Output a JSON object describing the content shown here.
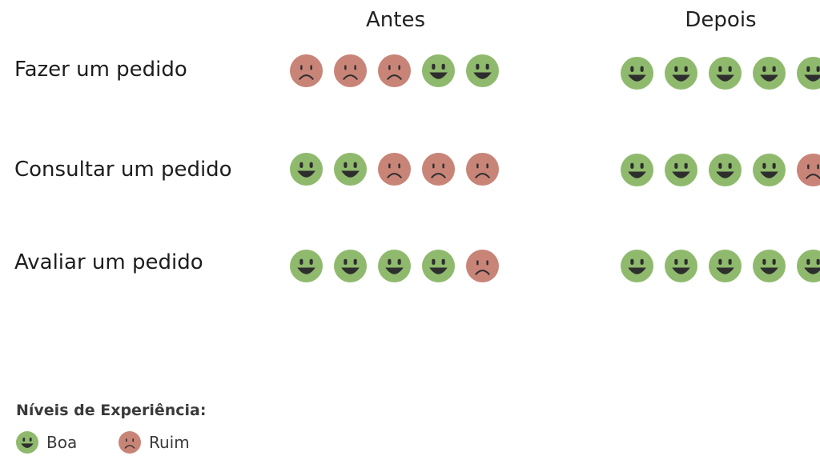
{
  "headers": {
    "before": "Antes",
    "after": "Depois"
  },
  "colors": {
    "good": "#8fba6d",
    "bad": "#c98478",
    "feature": "#2e2e2e"
  },
  "chart_data": {
    "type": "table",
    "columns": [
      "Antes",
      "Depois"
    ],
    "rows": [
      {
        "task": "Fazer um pedido",
        "before": [
          "Ruim",
          "Ruim",
          "Ruim",
          "Boa",
          "Boa"
        ],
        "after": [
          "Boa",
          "Boa",
          "Boa",
          "Boa",
          "Boa"
        ]
      },
      {
        "task": "Consultar um pedido",
        "before": [
          "Boa",
          "Boa",
          "Ruim",
          "Ruim",
          "Ruim"
        ],
        "after": [
          "Boa",
          "Boa",
          "Boa",
          "Boa",
          "Ruim"
        ]
      },
      {
        "task": "Avaliar um pedido",
        "before": [
          "Boa",
          "Boa",
          "Boa",
          "Boa",
          "Ruim"
        ],
        "after": [
          "Boa",
          "Boa",
          "Boa",
          "Boa",
          "Boa"
        ]
      }
    ]
  },
  "legend": {
    "title": "Níveis de Experiência:",
    "good_label": "Boa",
    "bad_label": "Ruim"
  }
}
